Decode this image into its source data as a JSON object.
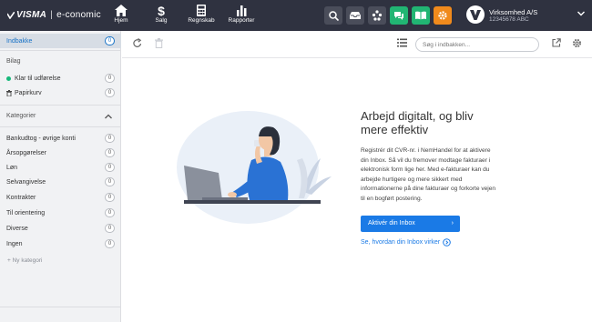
{
  "topbar": {
    "logo_text": "VISMA",
    "product": "e-conomic",
    "nav": [
      {
        "label": "Hjem",
        "icon": "home-icon"
      },
      {
        "label": "Salg",
        "icon": "dollar-icon"
      },
      {
        "label": "Regnskab",
        "icon": "calculator-icon"
      },
      {
        "label": "Rapporter",
        "icon": "bar-chart-icon"
      }
    ],
    "company_name": "Virksomhed A/S",
    "company_cvr": "12345678 ABC",
    "colors": {
      "bar": "#2f3240",
      "green": "#21b573",
      "orange": "#f08a1c",
      "dark_btn": "#4a4d5a"
    }
  },
  "sidebar": {
    "inbox_label": "Indbakke",
    "inbox_count": "0",
    "bilag_heading": "Bilag",
    "klar_label": "Klar til udførelse",
    "klar_count": "0",
    "papirkurv_label": "Papirkurv",
    "papirkurv_count": "0",
    "kategorier_heading": "Kategorier",
    "categories": [
      {
        "label": "Bankudtog - øvrige konti",
        "count": "0"
      },
      {
        "label": "Årsopgørelser",
        "count": "0"
      },
      {
        "label": "Løn",
        "count": "0"
      },
      {
        "label": "Selvangivelse",
        "count": "0"
      },
      {
        "label": "Kontrakter",
        "count": "0"
      },
      {
        "label": "Til orientering",
        "count": "0"
      },
      {
        "label": "Diverse",
        "count": "0"
      },
      {
        "label": "Ingen",
        "count": "0"
      }
    ],
    "new_category": "+ Ny kategori"
  },
  "main": {
    "search_placeholder": "Søg i indbakken...",
    "headline": "Arbejd digitalt, og bliv mere effektiv",
    "body": "Registrér dit CVR-nr. i NemHandel for at aktivere din Inbox. Så vil du fremover modtage fakturaer i elektronisk form lige her. Med e-fakturaer kan du arbejde hurtigere og mere sikkert med informationerne på dine fakturaer og forkorte vejen til en bogført postering.",
    "cta_label": "Aktivér din Inbox",
    "help_link": "Se, hvordan din Inbox virker"
  }
}
